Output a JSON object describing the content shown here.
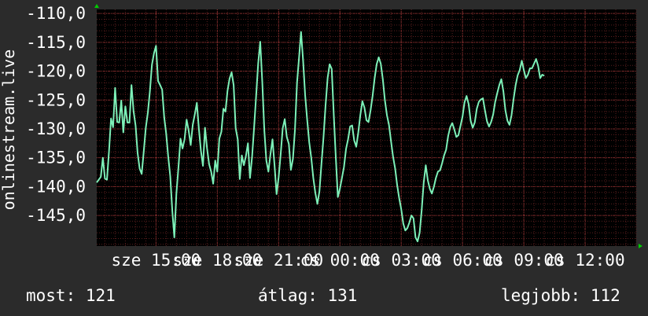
{
  "chart_data": {
    "type": "line",
    "ylabel": "onlinestream.live",
    "yticks": [
      "-110,0",
      "-115,0",
      "-120,0",
      "-125,0",
      "-130,0",
      "-135,0",
      "-140,0",
      "-145,0"
    ],
    "ytick_values": [
      -110,
      -115,
      -120,
      -125,
      -130,
      -135,
      -140,
      -145
    ],
    "ylim": [
      -150.3,
      -109.3
    ],
    "xticks": [
      "sze 15:00",
      "sze 18:00",
      "sze 21:00",
      "cs 00:00",
      "cs 03:00",
      "cs 06:00",
      "cs 09:00",
      "cs 12:00"
    ],
    "xtick_values": [
      3,
      6,
      9,
      12,
      15,
      18,
      21,
      24
    ],
    "xlim": [
      0.1,
      26.5
    ],
    "grid": true,
    "line_color": "#7df0b8",
    "series": [
      {
        "values": [
          [
            0.1,
            -139.3
          ],
          [
            0.3,
            -138.3
          ],
          [
            0.4,
            -135.0
          ],
          [
            0.5,
            -138.6
          ],
          [
            0.6,
            -138.8
          ],
          [
            0.7,
            -133.9
          ],
          [
            0.8,
            -128.2
          ],
          [
            0.9,
            -129.7
          ],
          [
            1.0,
            -122.9
          ],
          [
            1.1,
            -128.8
          ],
          [
            1.2,
            -128.9
          ],
          [
            1.3,
            -125.1
          ],
          [
            1.4,
            -130.6
          ],
          [
            1.5,
            -126.1
          ],
          [
            1.6,
            -128.9
          ],
          [
            1.7,
            -128.9
          ],
          [
            1.8,
            -122.4
          ],
          [
            1.9,
            -126.9
          ],
          [
            2.0,
            -129.4
          ],
          [
            2.1,
            -134.2
          ],
          [
            2.2,
            -136.9
          ],
          [
            2.3,
            -137.8
          ],
          [
            2.4,
            -133.9
          ],
          [
            2.5,
            -129.8
          ],
          [
            2.6,
            -127.2
          ],
          [
            2.7,
            -123.5
          ],
          [
            2.8,
            -118.9
          ],
          [
            2.9,
            -116.9
          ],
          [
            3.0,
            -115.6
          ],
          [
            3.1,
            -121.7
          ],
          [
            3.2,
            -122.4
          ],
          [
            3.3,
            -123.2
          ],
          [
            3.4,
            -128.0
          ],
          [
            3.5,
            -130.8
          ],
          [
            3.6,
            -134.8
          ],
          [
            3.7,
            -138.2
          ],
          [
            3.8,
            -144.2
          ],
          [
            3.9,
            -148.8
          ],
          [
            4.0,
            -141.2
          ],
          [
            4.1,
            -136.7
          ],
          [
            4.2,
            -131.7
          ],
          [
            4.3,
            -133.4
          ],
          [
            4.4,
            -131.8
          ],
          [
            4.5,
            -128.4
          ],
          [
            4.6,
            -130.3
          ],
          [
            4.7,
            -132.8
          ],
          [
            4.8,
            -129.3
          ],
          [
            4.9,
            -127.5
          ],
          [
            5.0,
            -125.5
          ],
          [
            5.1,
            -130.0
          ],
          [
            5.2,
            -133.8
          ],
          [
            5.3,
            -136.4
          ],
          [
            5.4,
            -129.8
          ],
          [
            5.5,
            -133.4
          ],
          [
            5.6,
            -136.1
          ],
          [
            5.7,
            -137.4
          ],
          [
            5.8,
            -139.5
          ],
          [
            5.9,
            -135.5
          ],
          [
            6.0,
            -137.4
          ],
          [
            6.1,
            -131.7
          ],
          [
            6.2,
            -130.5
          ],
          [
            6.3,
            -126.5
          ],
          [
            6.4,
            -127.0
          ],
          [
            6.5,
            -123.4
          ],
          [
            6.6,
            -121.3
          ],
          [
            6.7,
            -120.2
          ],
          [
            6.8,
            -122.4
          ],
          [
            6.9,
            -129.9
          ],
          [
            7.0,
            -131.8
          ],
          [
            7.1,
            -138.7
          ],
          [
            7.2,
            -134.6
          ],
          [
            7.3,
            -136.3
          ],
          [
            7.4,
            -134.7
          ],
          [
            7.5,
            -132.5
          ],
          [
            7.6,
            -138.5
          ],
          [
            7.7,
            -134.9
          ],
          [
            7.8,
            -129.8
          ],
          [
            7.9,
            -124.3
          ],
          [
            8.0,
            -118.7
          ],
          [
            8.1,
            -114.9
          ],
          [
            8.2,
            -121.8
          ],
          [
            8.3,
            -130.2
          ],
          [
            8.4,
            -135.5
          ],
          [
            8.5,
            -137.4
          ],
          [
            8.6,
            -134.4
          ],
          [
            8.7,
            -131.8
          ],
          [
            8.8,
            -136.3
          ],
          [
            8.9,
            -141.3
          ],
          [
            9.0,
            -138.4
          ],
          [
            9.1,
            -134.4
          ],
          [
            9.2,
            -129.9
          ],
          [
            9.3,
            -128.3
          ],
          [
            9.4,
            -131.4
          ],
          [
            9.5,
            -132.6
          ],
          [
            9.6,
            -137.1
          ],
          [
            9.7,
            -135.2
          ],
          [
            9.8,
            -130.1
          ],
          [
            9.9,
            -122.0
          ],
          [
            10.0,
            -117.6
          ],
          [
            10.1,
            -113.2
          ],
          [
            10.2,
            -118.1
          ],
          [
            10.3,
            -124.1
          ],
          [
            10.4,
            -128.4
          ],
          [
            10.5,
            -132.3
          ],
          [
            10.6,
            -135.0
          ],
          [
            10.7,
            -138.5
          ],
          [
            10.8,
            -141.1
          ],
          [
            10.9,
            -143.0
          ],
          [
            11.0,
            -140.8
          ],
          [
            11.1,
            -136.0
          ],
          [
            11.2,
            -131.4
          ],
          [
            11.3,
            -125.9
          ],
          [
            11.4,
            -121.2
          ],
          [
            11.5,
            -118.8
          ],
          [
            11.6,
            -119.6
          ],
          [
            11.7,
            -127.5
          ],
          [
            11.8,
            -134.9
          ],
          [
            11.9,
            -141.8
          ],
          [
            12.0,
            -140.4
          ],
          [
            12.1,
            -138.5
          ],
          [
            12.2,
            -136.6
          ],
          [
            12.3,
            -133.5
          ],
          [
            12.4,
            -131.8
          ],
          [
            12.5,
            -129.6
          ],
          [
            12.6,
            -129.4
          ],
          [
            12.7,
            -132.0
          ],
          [
            12.8,
            -133.1
          ],
          [
            12.9,
            -130.6
          ],
          [
            13.0,
            -127.6
          ],
          [
            13.1,
            -125.2
          ],
          [
            13.2,
            -126.3
          ],
          [
            13.3,
            -128.5
          ],
          [
            13.4,
            -128.8
          ],
          [
            13.5,
            -126.8
          ],
          [
            13.6,
            -124.3
          ],
          [
            13.7,
            -121.2
          ],
          [
            13.8,
            -118.8
          ],
          [
            13.9,
            -117.6
          ],
          [
            14.0,
            -118.7
          ],
          [
            14.1,
            -121.4
          ],
          [
            14.2,
            -125.0
          ],
          [
            14.3,
            -127.6
          ],
          [
            14.4,
            -129.3
          ],
          [
            14.5,
            -132.1
          ],
          [
            14.6,
            -134.8
          ],
          [
            14.7,
            -136.8
          ],
          [
            14.8,
            -139.7
          ],
          [
            14.9,
            -142.0
          ],
          [
            15.0,
            -143.9
          ],
          [
            15.1,
            -146.4
          ],
          [
            15.2,
            -147.6
          ],
          [
            15.3,
            -147.2
          ],
          [
            15.4,
            -146.2
          ],
          [
            15.5,
            -145.0
          ],
          [
            15.6,
            -145.5
          ],
          [
            15.7,
            -148.8
          ],
          [
            15.8,
            -149.5
          ],
          [
            15.9,
            -148.0
          ],
          [
            16.0,
            -144.1
          ],
          [
            16.1,
            -139.3
          ],
          [
            16.2,
            -136.3
          ],
          [
            16.3,
            -138.9
          ],
          [
            16.4,
            -140.4
          ],
          [
            16.5,
            -141.2
          ],
          [
            16.6,
            -140.0
          ],
          [
            16.7,
            -138.5
          ],
          [
            16.8,
            -137.4
          ],
          [
            16.9,
            -137.2
          ],
          [
            17.0,
            -136.0
          ],
          [
            17.1,
            -134.6
          ],
          [
            17.2,
            -133.6
          ],
          [
            17.3,
            -131.2
          ],
          [
            17.4,
            -129.7
          ],
          [
            17.5,
            -129.0
          ],
          [
            17.6,
            -130.1
          ],
          [
            17.7,
            -131.4
          ],
          [
            17.8,
            -131.1
          ],
          [
            17.9,
            -129.5
          ],
          [
            18.0,
            -127.9
          ],
          [
            18.1,
            -125.4
          ],
          [
            18.2,
            -124.3
          ],
          [
            18.3,
            -125.7
          ],
          [
            18.4,
            -128.6
          ],
          [
            18.5,
            -129.8
          ],
          [
            18.6,
            -128.9
          ],
          [
            18.7,
            -126.5
          ],
          [
            18.8,
            -125.3
          ],
          [
            18.9,
            -124.9
          ],
          [
            19.0,
            -124.7
          ],
          [
            19.1,
            -126.8
          ],
          [
            19.2,
            -128.7
          ],
          [
            19.3,
            -129.6
          ],
          [
            19.4,
            -128.8
          ],
          [
            19.5,
            -127.5
          ],
          [
            19.6,
            -125.3
          ],
          [
            19.7,
            -123.8
          ],
          [
            19.8,
            -122.4
          ],
          [
            19.9,
            -121.4
          ],
          [
            20.0,
            -123.5
          ],
          [
            20.1,
            -126.8
          ],
          [
            20.2,
            -128.6
          ],
          [
            20.3,
            -129.3
          ],
          [
            20.4,
            -127.6
          ],
          [
            20.5,
            -124.8
          ],
          [
            20.6,
            -122.4
          ],
          [
            20.7,
            -120.7
          ],
          [
            20.8,
            -119.8
          ],
          [
            20.9,
            -118.2
          ],
          [
            21.0,
            -119.8
          ],
          [
            21.1,
            -121.2
          ],
          [
            21.2,
            -120.6
          ],
          [
            21.3,
            -119.5
          ],
          [
            21.4,
            -119.5
          ],
          [
            21.5,
            -118.7
          ],
          [
            21.6,
            -117.9
          ],
          [
            21.7,
            -119.1
          ],
          [
            21.8,
            -121.2
          ],
          [
            21.9,
            -120.6
          ],
          [
            22.0,
            -120.8
          ]
        ]
      }
    ]
  },
  "footer": {
    "now_label": "most:",
    "now_value": "121",
    "avg_label": "átlag:",
    "avg_value": "131",
    "best_label": "legjobb:",
    "best_value": "112"
  }
}
